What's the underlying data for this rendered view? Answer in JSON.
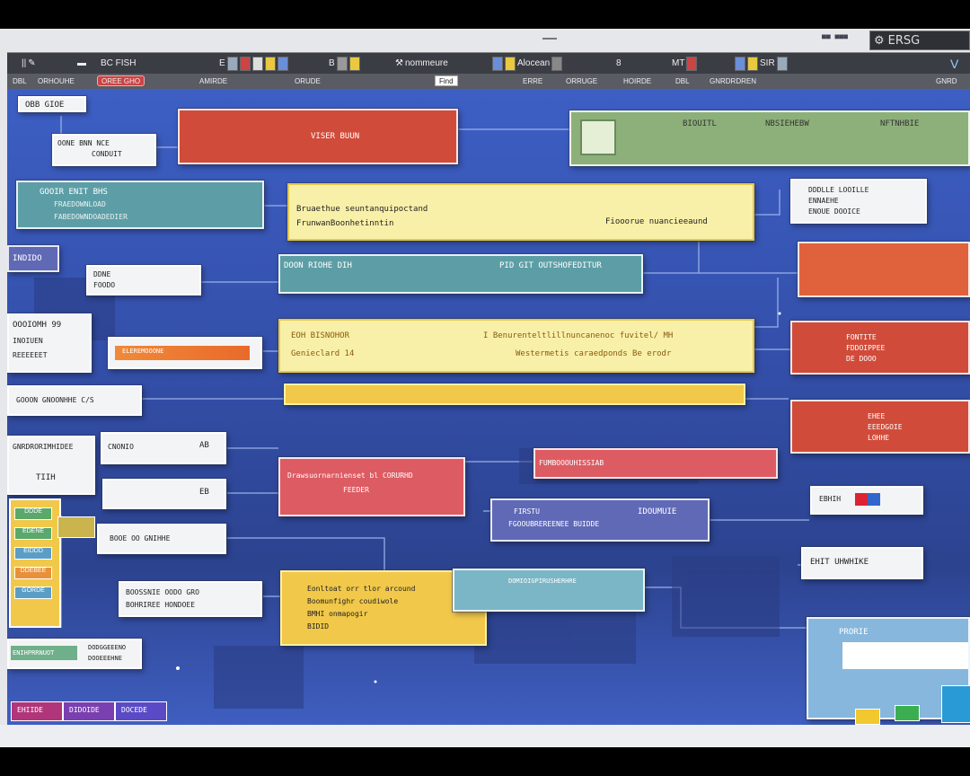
{
  "window": {
    "title_right": "■■ ■■■",
    "title_box_label": "ERSG"
  },
  "toolbar": {
    "items": [
      {
        "label": "||"
      },
      {
        "label": "BC FISH"
      },
      {
        "label": "E"
      },
      {
        "label": "B"
      },
      {
        "label": "nommeure"
      },
      {
        "label": "Alocean"
      },
      {
        "label": "8"
      },
      {
        "label": "MT"
      },
      {
        "label": "SIR"
      },
      {
        "label": "V"
      }
    ]
  },
  "tabs": [
    {
      "label": "DBL"
    },
    {
      "label": "ORHOUHE"
    },
    {
      "label": "OREE GHO"
    },
    {
      "label": "AMIRDE"
    },
    {
      "label": "ORUDE"
    },
    {
      "label": "Find"
    },
    {
      "label": "ERRE"
    },
    {
      "label": "ORRUGE"
    },
    {
      "label": "HOIRDE"
    },
    {
      "label": "DBL"
    },
    {
      "label": "GNRDRDREN"
    },
    {
      "label": "GNRD"
    }
  ],
  "nodes": {
    "top_left_label": "OBB GIOE",
    "top_red": "VISER BUUN",
    "top_green_a": "BIOUITL",
    "top_green_b": "NBSIEHEBW",
    "top_green_c": "NFTNHBIE",
    "left_box1_l1": "OONE BNN NCE",
    "left_box1_l2": "CONDUIT",
    "left_teal_l1": "GOOIR ENIT BHS",
    "left_teal_l2": "FRAEDOWNLOAD",
    "left_teal_l3": "FABEDOWNDOADEDIER",
    "yellow1_l1": "Bruaethue seuntanquipoctand",
    "yellow1_l2": "FrunwanBoonhetinntin",
    "yellow1_r": "Fiooorue nuancieeaund",
    "right_white1_l1": "DDDLLE LOOILLE",
    "right_white1_l2": "ENNAEHE",
    "right_white1_l3": "ENOUE DOOICE",
    "teal_mid_l": "DOON RIOHE DIH",
    "teal_mid_r": "PID GIT OUTSHOFEDITUR",
    "left_purple": "INDIDO",
    "left_small": "DDNE",
    "left_small2": "FOODO",
    "left_grey1_l1": "OOOIOMH 99",
    "left_grey1_l2": "INOIUEN",
    "left_grey1_l3": "REEEEEET",
    "orange_bar": "ELEREMOOONE",
    "yellow2_l1": "EOH BISNOHOR",
    "yellow2_l2": "Genieclard 14",
    "yellow2_r1": "I Benurenteltlillnuncanenoc fuvitel/ MH",
    "yellow2_r2": "Westermetis caraedponds Be erodr",
    "red_right1_l1": "FONTITE",
    "red_right1_l2": "FDDOIPPEE",
    "red_right1_l3": "DE DOOO",
    "left_grey2": "GOOON GNOONHHE C/S",
    "red_right2_l1": "EHEE",
    "red_right2_l2": "EEEDGOIE",
    "red_right2_l3": "LOHHE",
    "left_box2_l1": "GNRDRORIMHIDEE",
    "left_box2_l2": "TIIH",
    "left_box3_l1": "CNONIO",
    "left_box3_r": "AB",
    "pink_bar": "FUMBOOOUHISSIAB",
    "pink_mid_l1": "Drawsuornarnienset bl CORURHD",
    "pink_mid_l2": "FEEDER",
    "left_box4": "EB",
    "purple_mid_l1": "FIRSTU",
    "purple_mid_l2": "FGOOUBREREENEE BUIDDE",
    "purple_mid_r": "IDOUMUIE",
    "right_white2": "EBHIH",
    "left_box5": "BOOE OO GNIHHE",
    "right_white3": "EHIT UHWHIKE",
    "left_box6_l1": "BOOSSNIE OODO GRO",
    "left_box6_l2": "BOHRIREE HONDOEE",
    "yellow3_l1": "Eonltoat orr tlor arcound",
    "yellow3_l2": "Boomunfighr coudiwole",
    "yellow3_l3": "BMHI onmapogir",
    "yellow3_l4": "BIDID",
    "cyan_mid": "DOMIOIGPIRUSHERHRE",
    "left_green_items": [
      "DDDE",
      "EDENE",
      "EIDDD",
      "DDEBEE",
      "GORDE"
    ],
    "left_box7_l1": "DODGGEEENO",
    "left_box7_l2": "DOOEEEHNE",
    "left_green_strip": "ENIHPRRNUOT",
    "bottom_tabs": [
      "EHIIDE",
      "DIDOIDE",
      "DOCEDE"
    ],
    "lightblue_panel_label": "PRORIE"
  },
  "colors": {
    "canvas": "#3450ab",
    "toolbar": "#3b3d44",
    "red": "#d14b3a",
    "yellow": "#f8f0a8",
    "teal": "#5d9ea6",
    "green": "#8db07a"
  }
}
